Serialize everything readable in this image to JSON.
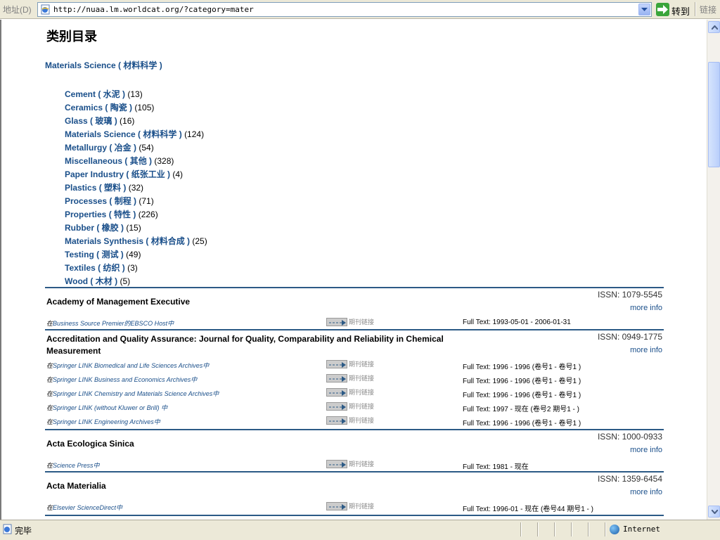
{
  "browser": {
    "address_label": "地址(D)",
    "url": "http://nuaa.lm.worldcat.org/?category=mater",
    "go_label": "转到",
    "links_label": "链接",
    "status_text": "完毕",
    "zone_text": "Internet"
  },
  "page": {
    "title": "类别目录",
    "category_heading": "Materials Science ( 材料科学 )",
    "subcategories": [
      {
        "name": "Cement ( 水泥 )",
        "count": "(13)"
      },
      {
        "name": "Ceramics ( 陶瓷 )",
        "count": "(105)"
      },
      {
        "name": "Glass ( 玻璃 )",
        "count": "(16)"
      },
      {
        "name": "Materials Science ( 材料科学 )",
        "count": "(124)"
      },
      {
        "name": "Metallurgy ( 冶金 )",
        "count": "(54)"
      },
      {
        "name": "Miscellaneous ( 其他 )",
        "count": "(328)"
      },
      {
        "name": "Paper Industry ( 纸张工业 )",
        "count": "(4)"
      },
      {
        "name": "Plastics ( 塑料 )",
        "count": "(32)"
      },
      {
        "name": "Processes ( 制程 )",
        "count": "(71)"
      },
      {
        "name": "Properties ( 特性 )",
        "count": "(226)"
      },
      {
        "name": "Rubber ( 橡胶 )",
        "count": "(15)"
      },
      {
        "name": "Materials Synthesis ( 材料合成 )",
        "count": "(25)"
      },
      {
        "name": "Testing ( 测试 )",
        "count": "(49)"
      },
      {
        "name": "Textiles ( 纺织 )",
        "count": "(3)"
      },
      {
        "name": "Wood ( 木材 )",
        "count": "(5)"
      }
    ],
    "link_label": "期刊链接",
    "more_info": "more info",
    "journals": [
      {
        "title": "Academy of Management Executive",
        "issn": "ISSN: 1079-5545",
        "holdings": [
          {
            "prefix": "在",
            "db": "Business Source Premier的EBSCO Host中",
            "full": "Full Text: 1993-05-01 - 2006-01-31"
          }
        ]
      },
      {
        "title": "Accreditation and Quality Assurance: Journal for Quality, Comparability and Reliability in Chemical Measurement",
        "issn": "ISSN: 0949-1775",
        "holdings": [
          {
            "prefix": "在",
            "db": "Springer LINK Biomedical and Life Sciences Archives中",
            "full": "Full Text: 1996 - 1996 (卷号1 - 卷号1 )"
          },
          {
            "prefix": "在",
            "db": "Springer LINK Business and Economics Archives中",
            "full": "Full Text: 1996 - 1996 (卷号1 - 卷号1 )"
          },
          {
            "prefix": "在",
            "db": "Springer LINK Chemistry and Materials Science Archives中",
            "full": "Full Text: 1996 - 1996 (卷号1 - 卷号1 )"
          },
          {
            "prefix": "在",
            "db": "Springer LINK (without Kluwer or Brill) 中",
            "full": "Full Text: 1997 - 现在 (卷号2 期号1 - )"
          },
          {
            "prefix": "在",
            "db": "Springer LINK Engineering Archives中",
            "full": "Full Text: 1996 - 1996 (卷号1 - 卷号1 )"
          }
        ]
      },
      {
        "title": "Acta Ecologica Sinica",
        "issn": "ISSN: 1000-0933",
        "holdings": [
          {
            "prefix": "在",
            "db": "Science Press中",
            "full": "Full Text: 1981 - 现在"
          }
        ]
      },
      {
        "title": "Acta Materialia",
        "issn": "ISSN: 1359-6454",
        "holdings": [
          {
            "prefix": "在",
            "db": "Elsevier ScienceDirect中",
            "full": "Full Text: 1996-01 - 现在 (卷号44 期号1 - )"
          }
        ]
      }
    ]
  }
}
